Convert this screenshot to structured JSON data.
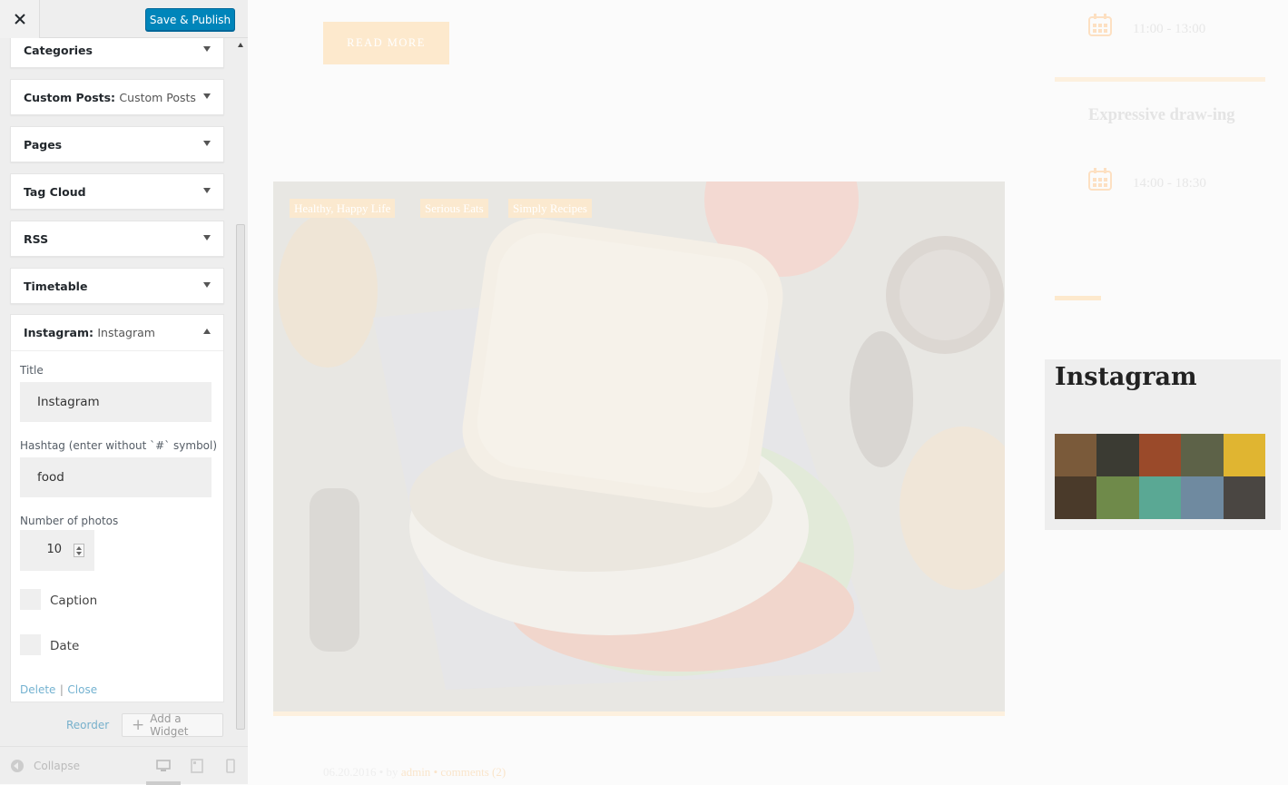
{
  "header": {
    "close_label": "×",
    "publish_label": "Save & Publish"
  },
  "widgets": [
    {
      "title": "Categories",
      "subtitle": ""
    },
    {
      "title": "Custom Posts:",
      "subtitle": "Custom Posts"
    },
    {
      "title": "Pages",
      "subtitle": ""
    },
    {
      "title": "Tag Cloud",
      "subtitle": ""
    },
    {
      "title": "RSS",
      "subtitle": ""
    },
    {
      "title": "Timetable",
      "subtitle": ""
    }
  ],
  "instagram_widget": {
    "title": "Instagram:",
    "subtitle": "Instagram",
    "title_label": "Title",
    "title_value": "Instagram",
    "hashtag_label": "Hashtag (enter without `#` symbol)",
    "hashtag_value": "food",
    "number_label": "Number of photos",
    "number_value": "10",
    "caption_label": "Caption",
    "date_label": "Date",
    "delete_label": "Delete",
    "separator": "|",
    "close_label": "Close"
  },
  "footer_actions": {
    "reorder_label": "Reorder",
    "add_widget_label": "Add a Widget",
    "collapse_label": "Collapse"
  },
  "preview": {
    "read_more": "READ MORE",
    "tags": [
      "Healthy, Happy Life",
      "Serious Eats",
      "Simply Recipes"
    ],
    "meta_date": "06.20.2016",
    "meta_by": "• by",
    "meta_author": "admin",
    "meta_comments": "• comments (2)",
    "time_1": "11:00 - 13:00",
    "event_title": "Expressive draw-ing",
    "time_2": "14:00 - 18:30",
    "instagram_heading": "Instagram"
  },
  "colors": {
    "accent": "#0085ba",
    "peach": "#fde9cd",
    "sidebar_bg": "#eeeeee"
  },
  "icons": [
    "close-icon",
    "calendar-icon",
    "plus-icon",
    "collapse-icon",
    "desktop-icon",
    "tablet-icon",
    "mobile-icon"
  ]
}
